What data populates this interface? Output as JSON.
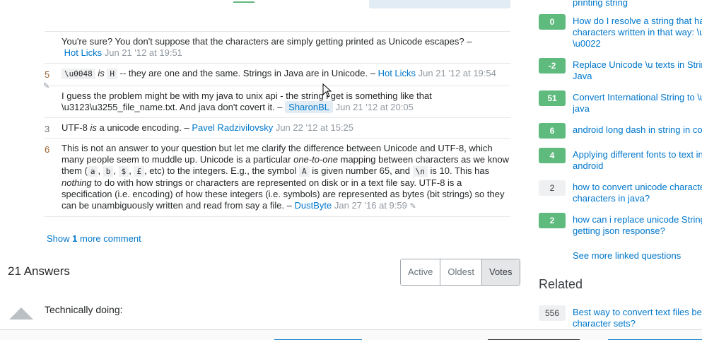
{
  "comments": [
    {
      "score": "",
      "text": "You're sure? You don't suppose that the characters are simply getting printed as Unicode escapes? –",
      "user": "Hot Licks",
      "date": "Jun 21 '12 at 19:51"
    },
    {
      "score": "5",
      "code1": "\\u0048",
      "is": "is",
      "code2": "H",
      "text": "-- they are one and the same. Strings in Java are in Unicode. –",
      "user": "Hot Licks",
      "date": "Jun 21 '12 at 19:54"
    },
    {
      "score": "",
      "text": "I guess the problem might be with my java to unix api - the string i get is something like that \\u3123\\u3255_file_name.txt. And java don't covert it. –",
      "user": "SharonBL",
      "date": "Jun 21 '12 at 20:05"
    },
    {
      "score": "3",
      "text_pre": "UTF-8",
      "is": "is",
      "text": "a unicode encoding. –",
      "user": "Pavel Radzivilovsky",
      "date": "Jun 22 '12 at 15:25"
    },
    {
      "score": "6",
      "p1": "This is not an answer to your question but let me clarify the difference between Unicode and UTF-8, which many people seem to muddle up. Unicode is a particular",
      "em1": "one-to-one",
      "p2": "mapping between characters as we know them (",
      "ca": "a",
      "cb": "b",
      "cc": "$",
      "cd": "£",
      "p3": ", etc) to the integers. E.g., the symbol",
      "ce": "A",
      "p4": "is given number 65, and",
      "cf": "\\n",
      "p5": "is 10. This has",
      "em2": "nothing",
      "p6": "to do with how strings or characters are represented on disk or in a text file say. UTF-8 is a specification (i.e. encoding) of how these integers (i.e. symbols) are represented as bytes (bit strings) so they can be unambiguously written and read from say a file. –",
      "user": "DustByte",
      "date": "Jan 27 '16 at 9:59"
    }
  ],
  "show_more": {
    "pre": "Show",
    "count": "1",
    "post": "more comment"
  },
  "answers": {
    "count_label": "21 Answers",
    "first_answer": "Technically doing:"
  },
  "sort_tabs": [
    "Active",
    "Oldest",
    "Votes"
  ],
  "sidebar": {
    "top_fragment": "printing string",
    "linked": [
      {
        "score": "0",
        "title1": "How do I resolve a string that ha",
        "title2": "characters written in that way: \\u",
        "title3": "\\u0022"
      },
      {
        "score": "-2",
        "title1": "Replace Unicode \\u texts in Strin",
        "title2": "Java"
      },
      {
        "score": "51",
        "title1": "Convert International String to \\u",
        "title2": "java"
      },
      {
        "score": "6",
        "title1": "android long dash in string in co"
      },
      {
        "score": "4",
        "title1": "Applying different fonts to text in",
        "title2": "android"
      },
      {
        "score": "2",
        "title1": "how to convert unicode characte",
        "title2": "characters in java?"
      },
      {
        "score": "2",
        "title1": "how can i replace unicode String",
        "title2": "getting json response?"
      }
    ],
    "see_more": "See more linked questions",
    "related_heading": "Related",
    "related": [
      {
        "score": "556",
        "title1": "Best way to convert text files be",
        "title2": "character sets?"
      }
    ]
  },
  "colors": {
    "accent": "#0077cc",
    "accepted": "#5eba7d",
    "owner_bg": "#e1ecf4"
  }
}
